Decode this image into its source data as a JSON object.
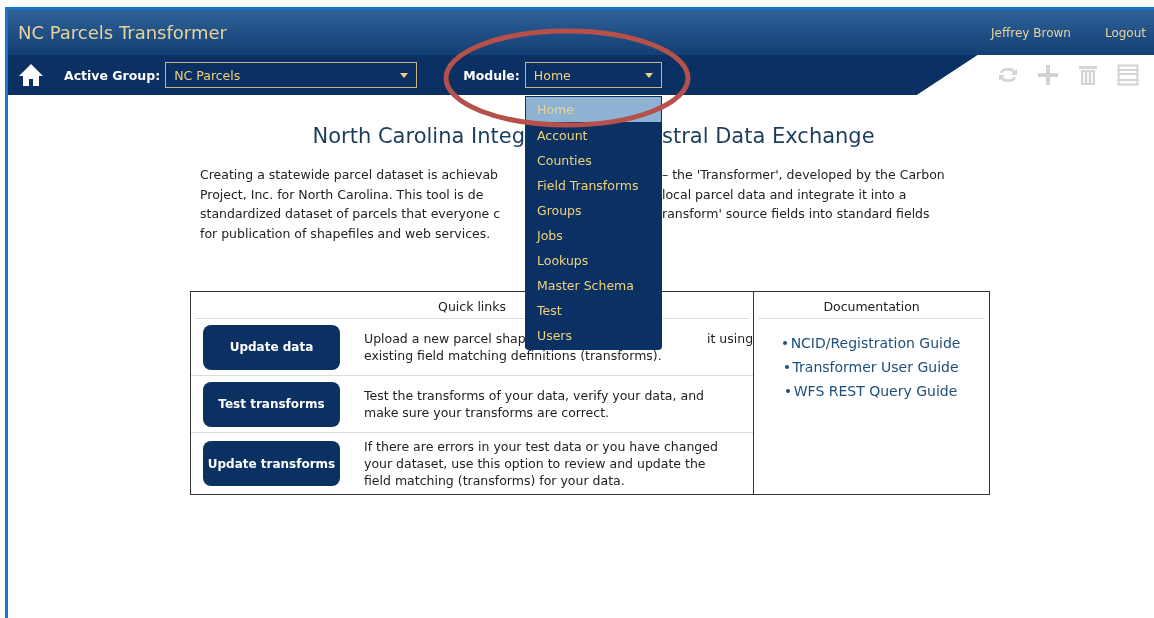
{
  "header": {
    "title": "NC Parcels Transformer",
    "user": "Jeffrey Brown",
    "logout": "Logout"
  },
  "toolbar": {
    "active_group_label": "Active Group:",
    "active_group": "NC Parcels",
    "module_label": "Module:",
    "module": "Home"
  },
  "module_menu": [
    {
      "label": "Home",
      "selected": true
    },
    {
      "label": "Account",
      "selected": false
    },
    {
      "label": "Counties",
      "selected": false
    },
    {
      "label": "Field Transforms",
      "selected": false
    },
    {
      "label": "Groups",
      "selected": false
    },
    {
      "label": "Jobs",
      "selected": false
    },
    {
      "label": "Lookups",
      "selected": false
    },
    {
      "label": "Master Schema",
      "selected": false
    },
    {
      "label": "Test",
      "selected": false
    },
    {
      "label": "Users",
      "selected": false
    }
  ],
  "intro": {
    "heading": [
      "North Carolina Integ",
      "stral Data Exchange"
    ],
    "paragraph_lines": [
      [
        "Creating a statewide parcel dataset is achievab",
        "– the 'Transformer', developed by the Carbon"
      ],
      [
        "Project, Inc. for North Carolina.  This tool is de",
        "local parcel data and integrate it into a"
      ],
      [
        "standardized dataset of parcels that everyone c",
        "ransform' source fields into standard fields"
      ],
      [
        "for publication of shapefiles and web services."
      ]
    ]
  },
  "quick_links": {
    "title": "Quick links",
    "rows": [
      {
        "button": "Update data",
        "description_lines": [
          [
            "Upload a new parcel shap",
            "it using"
          ],
          [
            "existing field matching definitions (transforms)."
          ]
        ]
      },
      {
        "button": "Test transforms",
        "description_lines": [
          [
            "Test the transforms of your data, verify your data, and"
          ],
          [
            "make sure your transforms are correct."
          ]
        ]
      },
      {
        "button": "Update transforms",
        "description_lines": [
          [
            "If there are errors in your test data or you have changed"
          ],
          [
            "your dataset, use this option to review and update the"
          ],
          [
            "field matching (transforms) for your data."
          ]
        ]
      }
    ]
  },
  "documentation": {
    "title": "Documentation",
    "links": [
      "NCID/Registration Guide",
      "Transformer User Guide",
      "WFS REST Query Guide"
    ]
  }
}
